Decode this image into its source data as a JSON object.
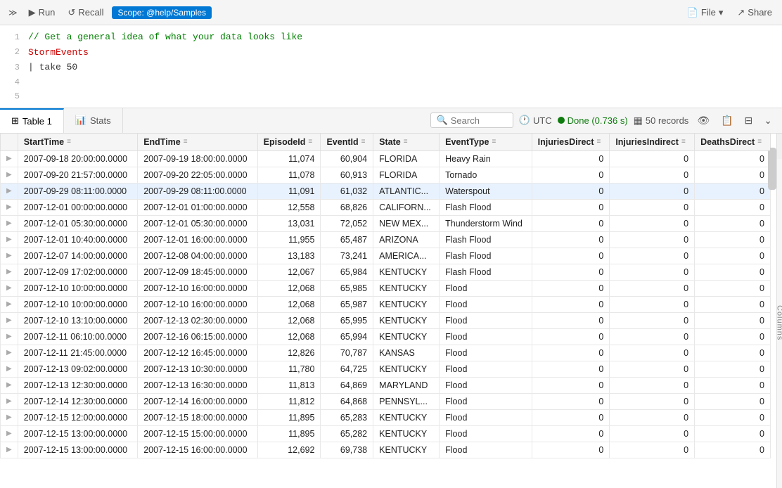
{
  "topbar": {
    "run_label": "Run",
    "recall_label": "Recall",
    "scope_label": "Scope: @help/Samples",
    "file_label": "File",
    "share_label": "Share"
  },
  "editor": {
    "lines": [
      {
        "num": 1,
        "type": "comment",
        "text": "// Get a general idea of what your data looks like"
      },
      {
        "num": 2,
        "type": "keyword",
        "text": "StormEvents"
      },
      {
        "num": 3,
        "type": "code",
        "text": "| take 50"
      },
      {
        "num": 4,
        "type": "empty",
        "text": ""
      },
      {
        "num": 5,
        "type": "empty",
        "text": ""
      }
    ]
  },
  "tabs": {
    "table_label": "Table 1",
    "stats_label": "Stats",
    "search_placeholder": "Search",
    "utc_label": "UTC",
    "done_label": "Done (0.736 s)",
    "records_label": "50 records"
  },
  "columns": [
    {
      "key": "expand",
      "label": ""
    },
    {
      "key": "StartTime",
      "label": "StartTime"
    },
    {
      "key": "EndTime",
      "label": "EndTime"
    },
    {
      "key": "EpisodeId",
      "label": "EpisodeId"
    },
    {
      "key": "EventId",
      "label": "EventId"
    },
    {
      "key": "State",
      "label": "State"
    },
    {
      "key": "EventType",
      "label": "EventType"
    },
    {
      "key": "InjuriesDirect",
      "label": "InjuriesDirect"
    },
    {
      "key": "InjuriesIndirect",
      "label": "InjuriesIndirect"
    },
    {
      "key": "DeathsDirect",
      "label": "DeathsDirect"
    }
  ],
  "rows": [
    {
      "expand": "▶",
      "StartTime": "2007-09-18 20:00:00.0000",
      "EndTime": "2007-09-19 18:00:00.0000",
      "EpisodeId": "11,074",
      "EventId": "60,904",
      "State": "FLORIDA",
      "EventType": "Heavy Rain",
      "InjuriesDirect": "0",
      "InjuriesIndirect": "0",
      "DeathsDirect": "0"
    },
    {
      "expand": "▶",
      "StartTime": "2007-09-20 21:57:00.0000",
      "EndTime": "2007-09-20 22:05:00.0000",
      "EpisodeId": "11,078",
      "EventId": "60,913",
      "State": "FLORIDA",
      "EventType": "Tornado",
      "InjuriesDirect": "0",
      "InjuriesIndirect": "0",
      "DeathsDirect": "0"
    },
    {
      "expand": "▶",
      "StartTime": "2007-09-29 08:11:00.0000",
      "EndTime": "2007-09-29 08:11:00.0000",
      "EpisodeId": "11,091",
      "EventId": "61,032",
      "State": "ATLANTIC...",
      "EventType": "Waterspout",
      "InjuriesDirect": "0",
      "InjuriesIndirect": "0",
      "DeathsDirect": "0",
      "hovered": true
    },
    {
      "expand": "▶",
      "StartTime": "2007-12-01 00:00:00.0000",
      "EndTime": "2007-12-01 01:00:00.0000",
      "EpisodeId": "12,558",
      "EventId": "68,826",
      "State": "CALIFORN...",
      "EventType": "Flash Flood",
      "InjuriesDirect": "0",
      "InjuriesIndirect": "0",
      "DeathsDirect": "0"
    },
    {
      "expand": "▶",
      "StartTime": "2007-12-01 05:30:00.0000",
      "EndTime": "2007-12-01 05:30:00.0000",
      "EpisodeId": "13,031",
      "EventId": "72,052",
      "State": "NEW MEX...",
      "EventType": "Thunderstorm Wind",
      "InjuriesDirect": "0",
      "InjuriesIndirect": "0",
      "DeathsDirect": "0"
    },
    {
      "expand": "▶",
      "StartTime": "2007-12-01 10:40:00.0000",
      "EndTime": "2007-12-01 16:00:00.0000",
      "EpisodeId": "11,955",
      "EventId": "65,487",
      "State": "ARIZONA",
      "EventType": "Flash Flood",
      "InjuriesDirect": "0",
      "InjuriesIndirect": "0",
      "DeathsDirect": "0"
    },
    {
      "expand": "▶",
      "StartTime": "2007-12-07 14:00:00.0000",
      "EndTime": "2007-12-08 04:00:00.0000",
      "EpisodeId": "13,183",
      "EventId": "73,241",
      "State": "AMERICA...",
      "EventType": "Flash Flood",
      "InjuriesDirect": "0",
      "InjuriesIndirect": "0",
      "DeathsDirect": "0"
    },
    {
      "expand": "▶",
      "StartTime": "2007-12-09 17:02:00.0000",
      "EndTime": "2007-12-09 18:45:00.0000",
      "EpisodeId": "12,067",
      "EventId": "65,984",
      "State": "KENTUCKY",
      "EventType": "Flash Flood",
      "InjuriesDirect": "0",
      "InjuriesIndirect": "0",
      "DeathsDirect": "0"
    },
    {
      "expand": "▶",
      "StartTime": "2007-12-10 10:00:00.0000",
      "EndTime": "2007-12-10 16:00:00.0000",
      "EpisodeId": "12,068",
      "EventId": "65,985",
      "State": "KENTUCKY",
      "EventType": "Flood",
      "InjuriesDirect": "0",
      "InjuriesIndirect": "0",
      "DeathsDirect": "0"
    },
    {
      "expand": "▶",
      "StartTime": "2007-12-10 10:00:00.0000",
      "EndTime": "2007-12-10 16:00:00.0000",
      "EpisodeId": "12,068",
      "EventId": "65,987",
      "State": "KENTUCKY",
      "EventType": "Flood",
      "InjuriesDirect": "0",
      "InjuriesIndirect": "0",
      "DeathsDirect": "0"
    },
    {
      "expand": "▶",
      "StartTime": "2007-12-10 13:10:00.0000",
      "EndTime": "2007-12-13 02:30:00.0000",
      "EpisodeId": "12,068",
      "EventId": "65,995",
      "State": "KENTUCKY",
      "EventType": "Flood",
      "InjuriesDirect": "0",
      "InjuriesIndirect": "0",
      "DeathsDirect": "0"
    },
    {
      "expand": "▶",
      "StartTime": "2007-12-11 06:10:00.0000",
      "EndTime": "2007-12-16 06:15:00.0000",
      "EpisodeId": "12,068",
      "EventId": "65,994",
      "State": "KENTUCKY",
      "EventType": "Flood",
      "InjuriesDirect": "0",
      "InjuriesIndirect": "0",
      "DeathsDirect": "0"
    },
    {
      "expand": "▶",
      "StartTime": "2007-12-11 21:45:00.0000",
      "EndTime": "2007-12-12 16:45:00.0000",
      "EpisodeId": "12,826",
      "EventId": "70,787",
      "State": "KANSAS",
      "EventType": "Flood",
      "InjuriesDirect": "0",
      "InjuriesIndirect": "0",
      "DeathsDirect": "0"
    },
    {
      "expand": "▶",
      "StartTime": "2007-12-13 09:02:00.0000",
      "EndTime": "2007-12-13 10:30:00.0000",
      "EpisodeId": "11,780",
      "EventId": "64,725",
      "State": "KENTUCKY",
      "EventType": "Flood",
      "InjuriesDirect": "0",
      "InjuriesIndirect": "0",
      "DeathsDirect": "0"
    },
    {
      "expand": "▶",
      "StartTime": "2007-12-13 12:30:00.0000",
      "EndTime": "2007-12-13 16:30:00.0000",
      "EpisodeId": "11,813",
      "EventId": "64,869",
      "State": "MARYLAND",
      "EventType": "Flood",
      "InjuriesDirect": "0",
      "InjuriesIndirect": "0",
      "DeathsDirect": "0"
    },
    {
      "expand": "▶",
      "StartTime": "2007-12-14 12:30:00.0000",
      "EndTime": "2007-12-14 16:00:00.0000",
      "EpisodeId": "11,812",
      "EventId": "64,868",
      "State": "PENNSYL...",
      "EventType": "Flood",
      "InjuriesDirect": "0",
      "InjuriesIndirect": "0",
      "DeathsDirect": "0"
    },
    {
      "expand": "▶",
      "StartTime": "2007-12-15 12:00:00.0000",
      "EndTime": "2007-12-15 18:00:00.0000",
      "EpisodeId": "11,895",
      "EventId": "65,283",
      "State": "KENTUCKY",
      "EventType": "Flood",
      "InjuriesDirect": "0",
      "InjuriesIndirect": "0",
      "DeathsDirect": "0"
    },
    {
      "expand": "▶",
      "StartTime": "2007-12-15 13:00:00.0000",
      "EndTime": "2007-12-15 15:00:00.0000",
      "EpisodeId": "11,895",
      "EventId": "65,282",
      "State": "KENTUCKY",
      "EventType": "Flood",
      "InjuriesDirect": "0",
      "InjuriesIndirect": "0",
      "DeathsDirect": "0"
    },
    {
      "expand": "▶",
      "StartTime": "2007-12-15 13:00:00.0000",
      "EndTime": "2007-12-15 16:00:00.0000",
      "EpisodeId": "12,692",
      "EventId": "69,738",
      "State": "KENTUCKY",
      "EventType": "Flood",
      "InjuriesDirect": "0",
      "InjuriesIndirect": "0",
      "DeathsDirect": "0"
    }
  ]
}
